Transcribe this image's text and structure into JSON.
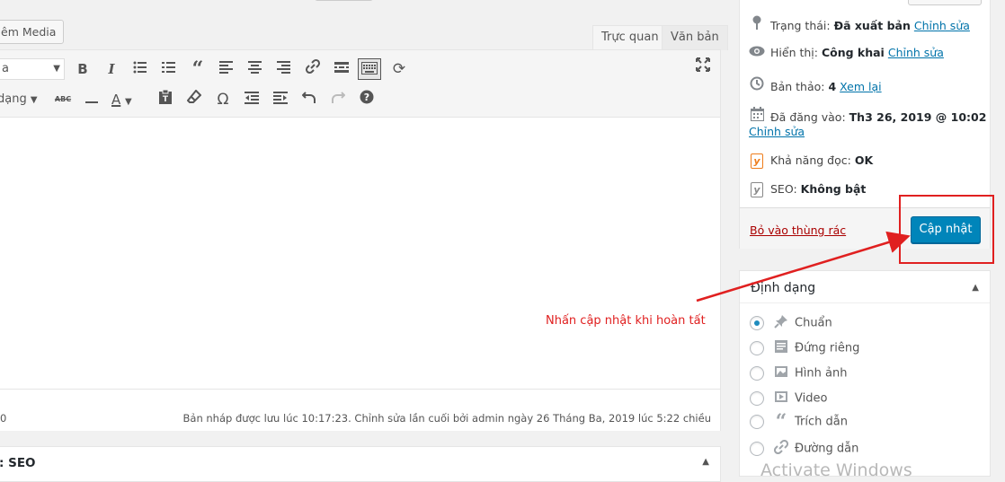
{
  "toolbar": {
    "add_media_label": "êm Media",
    "tab_visual": "Trực quan",
    "tab_text": "Văn bản",
    "format_select_value": "a",
    "color_label": "dạng"
  },
  "status": {
    "word_count": "0",
    "save_info": "Bản nháp được lưu lúc 10:17:23. Chỉnh sửa lần cuối bởi admin ngày 26 Tháng Ba, 2019 lúc 5:22 chiều"
  },
  "seo_box": {
    "title": ": SEO"
  },
  "publish": {
    "status_label": "Trạng thái:",
    "status_value": "Đã xuất bản",
    "status_edit": "Chỉnh sửa",
    "visibility_label": "Hiển thị:",
    "visibility_value": "Công khai",
    "visibility_edit": "Chỉnh sửa",
    "revisions_label": "Bản thảo:",
    "revisions_value": "4",
    "revisions_link": "Xem lại",
    "published_label": "Đã đăng vào:",
    "published_value": "Th3 26, 2019 @ 10:02",
    "published_edit": "Chỉnh sửa",
    "readability_label": "Khả năng đọc:",
    "readability_value": "OK",
    "seo_label": "SEO:",
    "seo_value": "Không bật",
    "trash_label": "Bỏ vào thùng rác",
    "update_label": "Cập nhật"
  },
  "format_box": {
    "title": "Định dạng",
    "options": [
      {
        "label": "Chuẩn",
        "icon": "pin-icon",
        "selected": true
      },
      {
        "label": "Đứng riêng",
        "icon": "aside-icon",
        "selected": false
      },
      {
        "label": "Hình ảnh",
        "icon": "image-icon",
        "selected": false
      },
      {
        "label": "Video",
        "icon": "video-icon",
        "selected": false
      },
      {
        "label": "Trích dẫn",
        "icon": "quote-icon",
        "selected": false
      },
      {
        "label": "Đường dẫn",
        "icon": "link-icon",
        "selected": false
      }
    ]
  },
  "annotation": {
    "text": "Nhấn cập nhật khi hoàn tất"
  },
  "watermark": {
    "text": "Activate Windows"
  },
  "colors": {
    "accent": "#0085ba",
    "annotation": "#e02020",
    "trash": "#a00000"
  }
}
